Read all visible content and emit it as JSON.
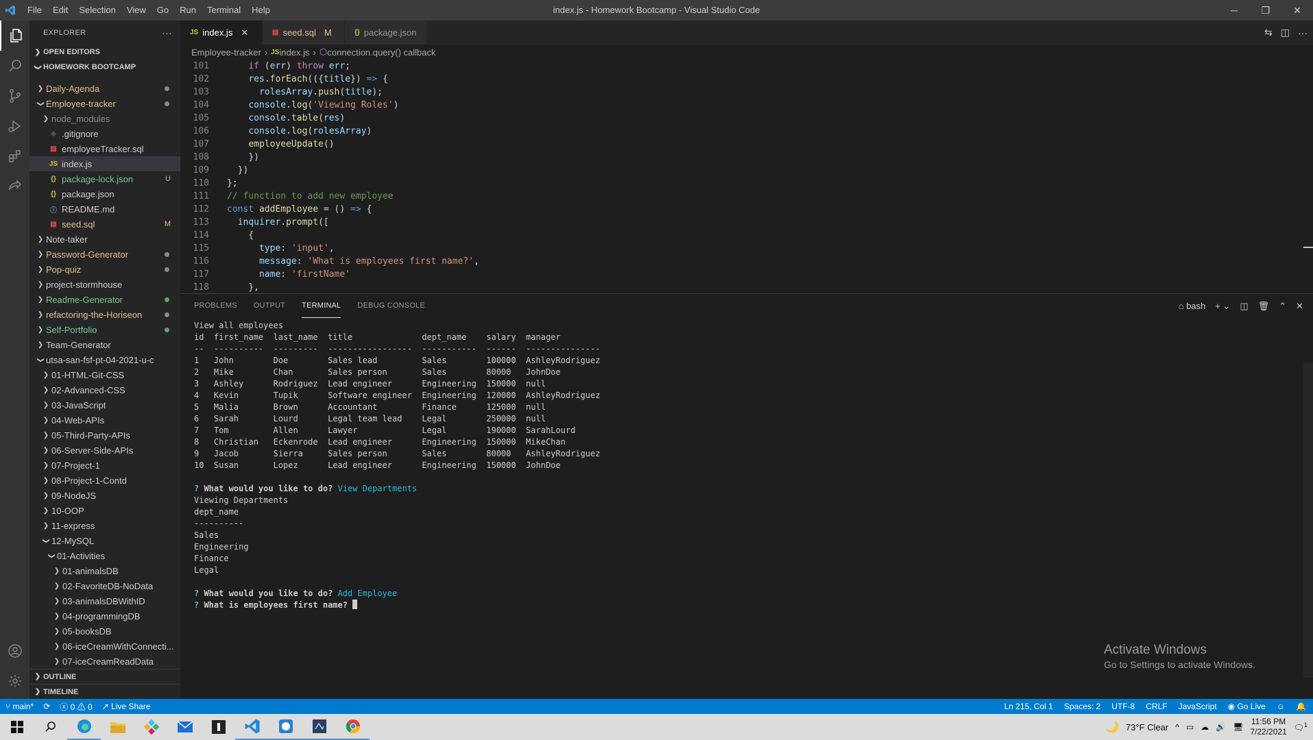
{
  "titlebar": {
    "title": "index.js - Homework Bootcamp - Visual Studio Code",
    "menu": [
      "File",
      "Edit",
      "Selection",
      "View",
      "Go",
      "Run",
      "Terminal",
      "Help"
    ],
    "controls": {
      "minimize": "─",
      "restore": "❐",
      "close": "✕"
    }
  },
  "activity_bar": {
    "icons": [
      "files-icon",
      "search-icon",
      "source-control-icon",
      "run-debug-icon",
      "extensions-icon",
      "live-share-icon"
    ],
    "bottom_icons": [
      "account-icon",
      "settings-gear-icon"
    ]
  },
  "sidebar": {
    "header": "EXPLORER",
    "more": "···",
    "open_editors": "OPEN EDITORS",
    "workspace": "HOMEWORK BOOTCAMP",
    "tree": [
      {
        "label": "Daily-Agenda",
        "type": "folder",
        "depth": 0,
        "open": false,
        "color": "#e2c08d",
        "deco": "dot"
      },
      {
        "label": "Employee-tracker",
        "type": "folder",
        "depth": 0,
        "open": true,
        "color": "#e2c08d",
        "deco": "dot"
      },
      {
        "label": "node_modules",
        "type": "folder",
        "depth": 1,
        "open": false,
        "color": "#8c8c8c",
        "deco": ""
      },
      {
        "label": ".gitignore",
        "type": "file",
        "icon": "◆",
        "iconColor": "#41535b",
        "depth": 1,
        "color": "#cccccc",
        "deco": ""
      },
      {
        "label": "employeeTracker.sql",
        "type": "file",
        "icon": "▤",
        "iconColor": "#f14c4c",
        "depth": 1,
        "color": "#cccccc",
        "deco": ""
      },
      {
        "label": "index.js",
        "type": "file",
        "icon": "JS",
        "iconColor": "#cbcb41",
        "depth": 1,
        "color": "#cccccc",
        "deco": "",
        "selected": true
      },
      {
        "label": "package-lock.json",
        "type": "file",
        "icon": "{}",
        "iconColor": "#cbcb41",
        "depth": 1,
        "color": "#73c991",
        "deco": "U"
      },
      {
        "label": "package.json",
        "type": "file",
        "icon": "{}",
        "iconColor": "#cbcb41",
        "depth": 1,
        "color": "#cccccc",
        "deco": ""
      },
      {
        "label": "README.md",
        "type": "file",
        "icon": "ⓘ",
        "iconColor": "#519aba",
        "depth": 1,
        "color": "#cccccc",
        "deco": ""
      },
      {
        "label": "seed.sql",
        "type": "file",
        "icon": "▤",
        "iconColor": "#f14c4c",
        "depth": 1,
        "color": "#e2c08d",
        "deco": "M"
      },
      {
        "label": "Note-taker",
        "type": "folder",
        "depth": 0,
        "open": false,
        "color": "#cccccc",
        "deco": ""
      },
      {
        "label": "Password-Generator",
        "type": "folder",
        "depth": 0,
        "open": false,
        "color": "#e2c08d",
        "deco": "dot"
      },
      {
        "label": "Pop-quiz",
        "type": "folder",
        "depth": 0,
        "open": false,
        "color": "#e2c08d",
        "deco": "dot"
      },
      {
        "label": "project-stormhouse",
        "type": "folder",
        "depth": 0,
        "open": false,
        "color": "#cccccc",
        "deco": ""
      },
      {
        "label": "Readme-Generator",
        "type": "folder",
        "depth": 0,
        "open": false,
        "color": "#73c991",
        "deco": "dot"
      },
      {
        "label": "refactoring-the-Horiseon",
        "type": "folder",
        "depth": 0,
        "open": false,
        "color": "#e2c08d",
        "deco": "dot"
      },
      {
        "label": "Self-Portfolio",
        "type": "folder",
        "depth": 0,
        "open": false,
        "color": "#73c991",
        "deco": "dot"
      },
      {
        "label": "Team-Generator",
        "type": "folder",
        "depth": 0,
        "open": false,
        "color": "#cccccc",
        "deco": ""
      },
      {
        "label": "utsa-san-fsf-pt-04-2021-u-c",
        "type": "folder",
        "depth": 0,
        "open": true,
        "color": "#cccccc",
        "deco": ""
      },
      {
        "label": "01-HTML-Git-CSS",
        "type": "folder",
        "depth": 1,
        "open": false,
        "color": "#cccccc",
        "deco": ""
      },
      {
        "label": "02-Advanced-CSS",
        "type": "folder",
        "depth": 1,
        "open": false,
        "color": "#cccccc",
        "deco": ""
      },
      {
        "label": "03-JavaScript",
        "type": "folder",
        "depth": 1,
        "open": false,
        "color": "#cccccc",
        "deco": ""
      },
      {
        "label": "04-Web-APIs",
        "type": "folder",
        "depth": 1,
        "open": false,
        "color": "#cccccc",
        "deco": ""
      },
      {
        "label": "05-Third-Party-APIs",
        "type": "folder",
        "depth": 1,
        "open": false,
        "color": "#cccccc",
        "deco": ""
      },
      {
        "label": "06-Server-Side-APIs",
        "type": "folder",
        "depth": 1,
        "open": false,
        "color": "#cccccc",
        "deco": ""
      },
      {
        "label": "07-Project-1",
        "type": "folder",
        "depth": 1,
        "open": false,
        "color": "#cccccc",
        "deco": ""
      },
      {
        "label": "08-Project-1-Contd",
        "type": "folder",
        "depth": 1,
        "open": false,
        "color": "#cccccc",
        "deco": ""
      },
      {
        "label": "09-NodeJS",
        "type": "folder",
        "depth": 1,
        "open": false,
        "color": "#cccccc",
        "deco": ""
      },
      {
        "label": "10-OOP",
        "type": "folder",
        "depth": 1,
        "open": false,
        "color": "#cccccc",
        "deco": ""
      },
      {
        "label": "11-express",
        "type": "folder",
        "depth": 1,
        "open": false,
        "color": "#cccccc",
        "deco": ""
      },
      {
        "label": "12-MySQL",
        "type": "folder",
        "depth": 1,
        "open": true,
        "color": "#cccccc",
        "deco": ""
      },
      {
        "label": "01-Activities",
        "type": "folder",
        "depth": 2,
        "open": true,
        "color": "#cccccc",
        "deco": ""
      },
      {
        "label": "01-animalsDB",
        "type": "folder",
        "depth": 3,
        "open": false,
        "color": "#cccccc",
        "deco": ""
      },
      {
        "label": "02-FavoriteDB-NoData",
        "type": "folder",
        "depth": 3,
        "open": false,
        "color": "#cccccc",
        "deco": ""
      },
      {
        "label": "03-animalsDBWithID",
        "type": "folder",
        "depth": 3,
        "open": false,
        "color": "#cccccc",
        "deco": ""
      },
      {
        "label": "04-programmingDB",
        "type": "folder",
        "depth": 3,
        "open": false,
        "color": "#cccccc",
        "deco": ""
      },
      {
        "label": "05-booksDB",
        "type": "folder",
        "depth": 3,
        "open": false,
        "color": "#cccccc",
        "deco": ""
      },
      {
        "label": "06-iceCreamWithConnecti...",
        "type": "folder",
        "depth": 3,
        "open": false,
        "color": "#cccccc",
        "deco": ""
      },
      {
        "label": "07-iceCreamReadData",
        "type": "folder",
        "depth": 3,
        "open": false,
        "color": "#cccccc",
        "deco": ""
      }
    ],
    "outline": "OUTLINE",
    "timeline": "TIMELINE"
  },
  "tabs": [
    {
      "label": "index.js",
      "icon": "JS",
      "iconColor": "#cbcb41",
      "active": true,
      "extra": "✕",
      "labelColor": "#ffffff"
    },
    {
      "label": "seed.sql",
      "icon": "▤",
      "iconColor": "#f14c4c",
      "active": false,
      "extra": "M",
      "labelColor": "#e2c08d"
    },
    {
      "label": "package.json",
      "icon": "{}",
      "iconColor": "#cbcb41",
      "active": false,
      "extra": "",
      "labelColor": "#969696"
    }
  ],
  "breadcrumb": [
    "Employee-tracker",
    "index.js",
    "connection.query() callback"
  ],
  "code": {
    "lines": [
      {
        "n": "101",
        "parts": [
          [
            "pl",
            "    "
          ],
          [
            "ctl",
            "if"
          ],
          [
            "pl",
            " ("
          ],
          [
            "var",
            "err"
          ],
          [
            "pl",
            ") "
          ],
          [
            "ctl",
            "throw"
          ],
          [
            "pl",
            " "
          ],
          [
            "var",
            "err"
          ],
          [
            "pl",
            ";"
          ]
        ]
      },
      {
        "n": "102",
        "parts": [
          [
            "pl",
            "    "
          ],
          [
            "var",
            "res"
          ],
          [
            "pl",
            "."
          ],
          [
            "fn",
            "forEach"
          ],
          [
            "pl",
            "(({"
          ],
          [
            "var",
            "title"
          ],
          [
            "pl",
            "}) "
          ],
          [
            "kw",
            "=>"
          ],
          [
            "pl",
            " {"
          ]
        ]
      },
      {
        "n": "103",
        "parts": [
          [
            "pl",
            "      "
          ],
          [
            "var",
            "rolesArray"
          ],
          [
            "pl",
            "."
          ],
          [
            "fn",
            "push"
          ],
          [
            "pl",
            "("
          ],
          [
            "var",
            "title"
          ],
          [
            "pl",
            ");"
          ]
        ]
      },
      {
        "n": "104",
        "parts": [
          [
            "pl",
            "    "
          ],
          [
            "var",
            "console"
          ],
          [
            "pl",
            "."
          ],
          [
            "fn",
            "log"
          ],
          [
            "pl",
            "("
          ],
          [
            "str",
            "'Viewing Roles'"
          ],
          [
            "pl",
            ")"
          ]
        ]
      },
      {
        "n": "105",
        "parts": [
          [
            "pl",
            "    "
          ],
          [
            "var",
            "console"
          ],
          [
            "pl",
            "."
          ],
          [
            "fn",
            "table"
          ],
          [
            "pl",
            "("
          ],
          [
            "var",
            "res"
          ],
          [
            "pl",
            ")"
          ]
        ]
      },
      {
        "n": "106",
        "parts": [
          [
            "pl",
            "    "
          ],
          [
            "var",
            "console"
          ],
          [
            "pl",
            "."
          ],
          [
            "fn",
            "log"
          ],
          [
            "pl",
            "("
          ],
          [
            "var",
            "rolesArray"
          ],
          [
            "pl",
            ")"
          ]
        ]
      },
      {
        "n": "107",
        "parts": [
          [
            "pl",
            "    "
          ],
          [
            "fn",
            "employeeUpdate"
          ],
          [
            "pl",
            "()"
          ]
        ]
      },
      {
        "n": "108",
        "parts": [
          [
            "pl",
            "    })"
          ]
        ]
      },
      {
        "n": "109",
        "parts": [
          [
            "pl",
            "  })"
          ]
        ]
      },
      {
        "n": "110",
        "parts": [
          [
            "pl",
            "};"
          ]
        ]
      },
      {
        "n": "111",
        "parts": [
          [
            "com",
            "// function to add new employee"
          ]
        ]
      },
      {
        "n": "112",
        "parts": [
          [
            "kw",
            "const"
          ],
          [
            "pl",
            " "
          ],
          [
            "fn",
            "addEmployee"
          ],
          [
            "pl",
            " = () "
          ],
          [
            "kw",
            "=>"
          ],
          [
            "pl",
            " {"
          ]
        ]
      },
      {
        "n": "113",
        "parts": [
          [
            "pl",
            "  "
          ],
          [
            "var",
            "inquirer"
          ],
          [
            "pl",
            "."
          ],
          [
            "fn",
            "prompt"
          ],
          [
            "pl",
            "(["
          ]
        ]
      },
      {
        "n": "114",
        "parts": [
          [
            "pl",
            "    {"
          ]
        ]
      },
      {
        "n": "115",
        "parts": [
          [
            "pl",
            "      "
          ],
          [
            "prp",
            "type"
          ],
          [
            "pl",
            ": "
          ],
          [
            "str",
            "'input'"
          ],
          [
            "pl",
            ","
          ]
        ]
      },
      {
        "n": "116",
        "parts": [
          [
            "pl",
            "      "
          ],
          [
            "prp",
            "message"
          ],
          [
            "pl",
            ": "
          ],
          [
            "str",
            "'What is employees first name?'"
          ],
          [
            "pl",
            ","
          ]
        ]
      },
      {
        "n": "117",
        "parts": [
          [
            "pl",
            "      "
          ],
          [
            "prp",
            "name"
          ],
          [
            "pl",
            ": "
          ],
          [
            "str",
            "'firstName'"
          ]
        ]
      },
      {
        "n": "118",
        "parts": [
          [
            "pl",
            "    },"
          ]
        ]
      }
    ]
  },
  "panel": {
    "tabs": [
      "PROBLEMS",
      "OUTPUT",
      "TERMINAL",
      "DEBUG CONSOLE"
    ],
    "active_tab": "TERMINAL",
    "shell": "bash",
    "terminal": {
      "header": "View all employees",
      "table_lines": [
        "id  first_name  last_name  title              dept_name    salary  manager",
        "--  ----------  ---------  -----------------  -----------  ------  ---------------",
        "1   John        Doe        Sales lead         Sales        100000  AshleyRodriguez",
        "2   Mike        Chan       Sales person       Sales        80000   JohnDoe",
        "3   Ashley      Rodriguez  Lead engineer      Engineering  150000  null",
        "4   Kevin       Tupik      Software engineer  Engineering  120000  AshleyRodriguez",
        "5   Malia       Brown      Accountant         Finance      125000  null",
        "6   Sarah       Lourd      Legal team lead    Legal        250000  null",
        "7   Tom         Allen      Lawyer             Legal        190000  SarahLourd",
        "8   Christian   Eckenrode  Lead engineer      Engineering  150000  MikeChan",
        "9   Jacob       Sierra     Sales person       Sales        80000   AshleyRodriguez",
        "10  Susan       Lopez      Lead engineer      Engineering  150000  JohnDoe"
      ],
      "q1": "What would you like to do?",
      "a1": "View Departments",
      "dept_output": [
        "Viewing Departments",
        "dept_name",
        "----------",
        "Sales",
        "Engineering",
        "Finance",
        "Legal"
      ],
      "q2": "What would you like to do?",
      "a2": "Add Employee",
      "q3": "What is employees first name?"
    }
  },
  "watermark": {
    "line1": "Activate Windows",
    "line2": "Go to Settings to activate Windows."
  },
  "statusbar": {
    "branch": "main*",
    "sync": "⟳",
    "errors": "0",
    "warnings": "0",
    "live_share": "Live Share",
    "position": "Ln 215, Col 1",
    "spaces": "Spaces: 2",
    "encoding": "UTF-8",
    "eol": "CRLF",
    "language": "JavaScript",
    "go_live": "Go Live"
  },
  "taskbar": {
    "weather": "73°F  Clear",
    "time": "11:56 PM",
    "date": "7/22/2021",
    "notifications": "1"
  }
}
